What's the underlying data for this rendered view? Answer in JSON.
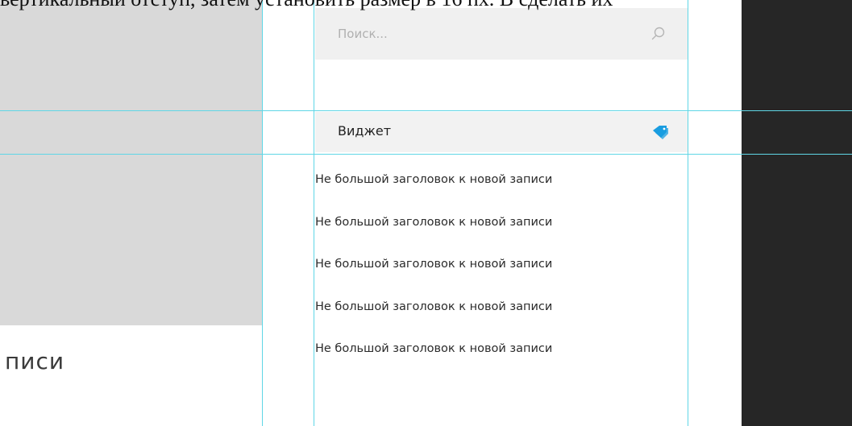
{
  "caption": {
    "text": "вертикальный отступ, затем установить размер в 16 пх. В сделать их"
  },
  "content": {
    "title_fragment": "писи"
  },
  "sidebar": {
    "search": {
      "placeholder": "Поиск...",
      "icon": "search-icon"
    },
    "widget": {
      "title": "Виджет",
      "icon": "tag-icon",
      "icon_color": "#1a9de0"
    },
    "posts": [
      "Не большой заголовок к новой записи",
      "Не большой заголовок к новой записи",
      "Не большой заголовок к новой записи",
      "Не большой заголовок к новой записи",
      "Не большой заголовок к новой записи"
    ]
  },
  "colors": {
    "guide_line": "#5fd6e6",
    "placeholder_gray": "#d9d9d9",
    "dark_panel": "#262626",
    "search_bg": "#f0f0f0",
    "widget_bg": "#f2f2f2"
  }
}
